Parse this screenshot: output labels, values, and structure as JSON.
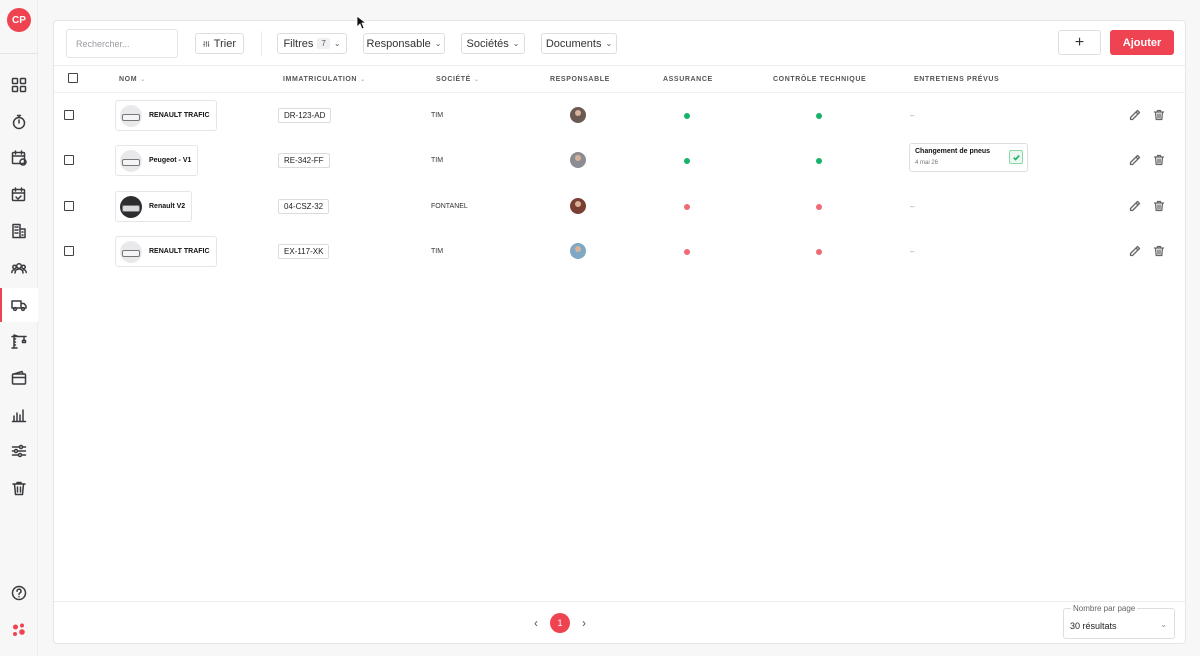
{
  "user": {
    "initials": "CP"
  },
  "sidebar": {
    "items": [
      {
        "icon": "grid-icon"
      },
      {
        "icon": "stopwatch-icon"
      },
      {
        "icon": "calendar-clock-icon"
      },
      {
        "icon": "calendar-check-icon"
      },
      {
        "icon": "building-icon"
      },
      {
        "icon": "team-icon"
      },
      {
        "icon": "truck-icon",
        "active": true
      },
      {
        "icon": "crane-icon"
      },
      {
        "icon": "wallet-icon"
      },
      {
        "icon": "bar-chart-icon"
      },
      {
        "icon": "sliders-icon"
      },
      {
        "icon": "trash-icon"
      }
    ],
    "bottom": [
      {
        "icon": "help-icon"
      },
      {
        "icon": "brand-logo-icon"
      }
    ]
  },
  "toolbar": {
    "search_placeholder": "Rechercher...",
    "sort_label": "Trier",
    "filters_label": "Filtres",
    "filters_count": "7",
    "responsable_label": "Responsable",
    "societes_label": "Sociétés",
    "documents_label": "Documents",
    "plus_label": "+",
    "add_label": "Ajouter"
  },
  "table": {
    "headers": {
      "nom": "NOM",
      "immatriculation": "IMMATRICULATION",
      "societe": "SOCIÉTÉ",
      "responsable": "RESPONSABLE",
      "assurance": "ASSURANCE",
      "controle": "CONTRÔLE TECHNIQUE",
      "entretiens": "ENTRETIENS PRÉVUS"
    },
    "rows": [
      {
        "name": "RENAULT TRAFIC",
        "plate": "DR-123-AD",
        "company": "TIM",
        "assurance": "ok",
        "controle": "ok",
        "maintenance": "–"
      },
      {
        "name": "Peugeot - V1",
        "plate": "RE-342-FF",
        "company": "TIM",
        "assurance": "ok",
        "controle": "ok",
        "maintenance_title": "Changement de pneus",
        "maintenance_date": "4 mai 26"
      },
      {
        "name": "Renault V2",
        "plate": "04-CSZ-32",
        "company": "FONTANEL",
        "assurance": "ko",
        "controle": "ko",
        "maintenance": "–"
      },
      {
        "name": "RENAULT TRAFIC",
        "plate": "EX-117-XK",
        "company": "TIM",
        "assurance": "ko",
        "controle": "ko",
        "maintenance": "–"
      }
    ]
  },
  "status_colors": {
    "ok": "#18b26a",
    "ko": "#ef6b73",
    "accent": "#ef4351"
  },
  "pagination": {
    "prev": "‹",
    "current_page": "1",
    "next": "›",
    "per_page_label": "Nombre par page",
    "per_page_value": "30 résultats"
  }
}
